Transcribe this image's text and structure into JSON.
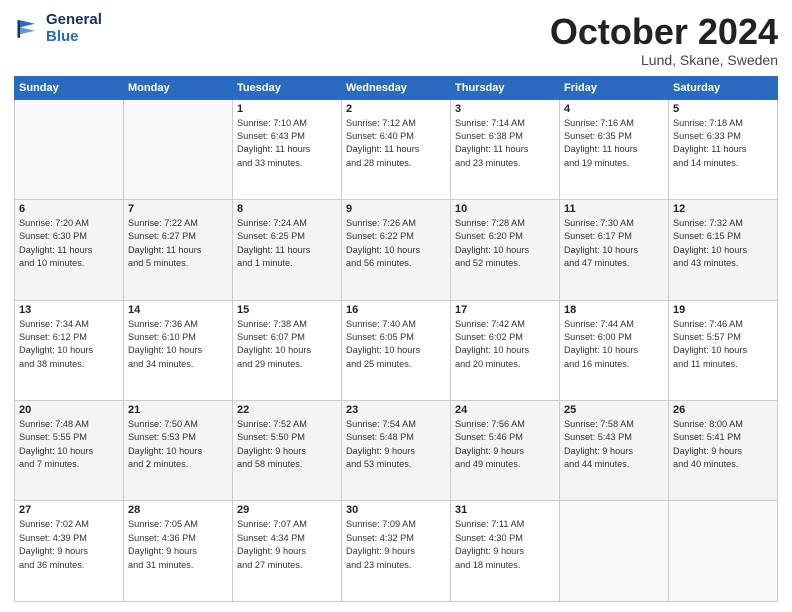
{
  "logo": {
    "line1": "General",
    "line2": "Blue"
  },
  "title": "October 2024",
  "subtitle": "Lund, Skane, Sweden",
  "days_of_week": [
    "Sunday",
    "Monday",
    "Tuesday",
    "Wednesday",
    "Thursday",
    "Friday",
    "Saturday"
  ],
  "weeks": [
    [
      {
        "day": "",
        "info": ""
      },
      {
        "day": "",
        "info": ""
      },
      {
        "day": "1",
        "info": "Sunrise: 7:10 AM\nSunset: 6:43 PM\nDaylight: 11 hours\nand 33 minutes."
      },
      {
        "day": "2",
        "info": "Sunrise: 7:12 AM\nSunset: 6:40 PM\nDaylight: 11 hours\nand 28 minutes."
      },
      {
        "day": "3",
        "info": "Sunrise: 7:14 AM\nSunset: 6:38 PM\nDaylight: 11 hours\nand 23 minutes."
      },
      {
        "day": "4",
        "info": "Sunrise: 7:16 AM\nSunset: 6:35 PM\nDaylight: 11 hours\nand 19 minutes."
      },
      {
        "day": "5",
        "info": "Sunrise: 7:18 AM\nSunset: 6:33 PM\nDaylight: 11 hours\nand 14 minutes."
      }
    ],
    [
      {
        "day": "6",
        "info": "Sunrise: 7:20 AM\nSunset: 6:30 PM\nDaylight: 11 hours\nand 10 minutes."
      },
      {
        "day": "7",
        "info": "Sunrise: 7:22 AM\nSunset: 6:27 PM\nDaylight: 11 hours\nand 5 minutes."
      },
      {
        "day": "8",
        "info": "Sunrise: 7:24 AM\nSunset: 6:25 PM\nDaylight: 11 hours\nand 1 minute."
      },
      {
        "day": "9",
        "info": "Sunrise: 7:26 AM\nSunset: 6:22 PM\nDaylight: 10 hours\nand 56 minutes."
      },
      {
        "day": "10",
        "info": "Sunrise: 7:28 AM\nSunset: 6:20 PM\nDaylight: 10 hours\nand 52 minutes."
      },
      {
        "day": "11",
        "info": "Sunrise: 7:30 AM\nSunset: 6:17 PM\nDaylight: 10 hours\nand 47 minutes."
      },
      {
        "day": "12",
        "info": "Sunrise: 7:32 AM\nSunset: 6:15 PM\nDaylight: 10 hours\nand 43 minutes."
      }
    ],
    [
      {
        "day": "13",
        "info": "Sunrise: 7:34 AM\nSunset: 6:12 PM\nDaylight: 10 hours\nand 38 minutes."
      },
      {
        "day": "14",
        "info": "Sunrise: 7:36 AM\nSunset: 6:10 PM\nDaylight: 10 hours\nand 34 minutes."
      },
      {
        "day": "15",
        "info": "Sunrise: 7:38 AM\nSunset: 6:07 PM\nDaylight: 10 hours\nand 29 minutes."
      },
      {
        "day": "16",
        "info": "Sunrise: 7:40 AM\nSunset: 6:05 PM\nDaylight: 10 hours\nand 25 minutes."
      },
      {
        "day": "17",
        "info": "Sunrise: 7:42 AM\nSunset: 6:02 PM\nDaylight: 10 hours\nand 20 minutes."
      },
      {
        "day": "18",
        "info": "Sunrise: 7:44 AM\nSunset: 6:00 PM\nDaylight: 10 hours\nand 16 minutes."
      },
      {
        "day": "19",
        "info": "Sunrise: 7:46 AM\nSunset: 5:57 PM\nDaylight: 10 hours\nand 11 minutes."
      }
    ],
    [
      {
        "day": "20",
        "info": "Sunrise: 7:48 AM\nSunset: 5:55 PM\nDaylight: 10 hours\nand 7 minutes."
      },
      {
        "day": "21",
        "info": "Sunrise: 7:50 AM\nSunset: 5:53 PM\nDaylight: 10 hours\nand 2 minutes."
      },
      {
        "day": "22",
        "info": "Sunrise: 7:52 AM\nSunset: 5:50 PM\nDaylight: 9 hours\nand 58 minutes."
      },
      {
        "day": "23",
        "info": "Sunrise: 7:54 AM\nSunset: 5:48 PM\nDaylight: 9 hours\nand 53 minutes."
      },
      {
        "day": "24",
        "info": "Sunrise: 7:56 AM\nSunset: 5:46 PM\nDaylight: 9 hours\nand 49 minutes."
      },
      {
        "day": "25",
        "info": "Sunrise: 7:58 AM\nSunset: 5:43 PM\nDaylight: 9 hours\nand 44 minutes."
      },
      {
        "day": "26",
        "info": "Sunrise: 8:00 AM\nSunset: 5:41 PM\nDaylight: 9 hours\nand 40 minutes."
      }
    ],
    [
      {
        "day": "27",
        "info": "Sunrise: 7:02 AM\nSunset: 4:39 PM\nDaylight: 9 hours\nand 36 minutes."
      },
      {
        "day": "28",
        "info": "Sunrise: 7:05 AM\nSunset: 4:36 PM\nDaylight: 9 hours\nand 31 minutes."
      },
      {
        "day": "29",
        "info": "Sunrise: 7:07 AM\nSunset: 4:34 PM\nDaylight: 9 hours\nand 27 minutes."
      },
      {
        "day": "30",
        "info": "Sunrise: 7:09 AM\nSunset: 4:32 PM\nDaylight: 9 hours\nand 23 minutes."
      },
      {
        "day": "31",
        "info": "Sunrise: 7:11 AM\nSunset: 4:30 PM\nDaylight: 9 hours\nand 18 minutes."
      },
      {
        "day": "",
        "info": ""
      },
      {
        "day": "",
        "info": ""
      }
    ]
  ]
}
